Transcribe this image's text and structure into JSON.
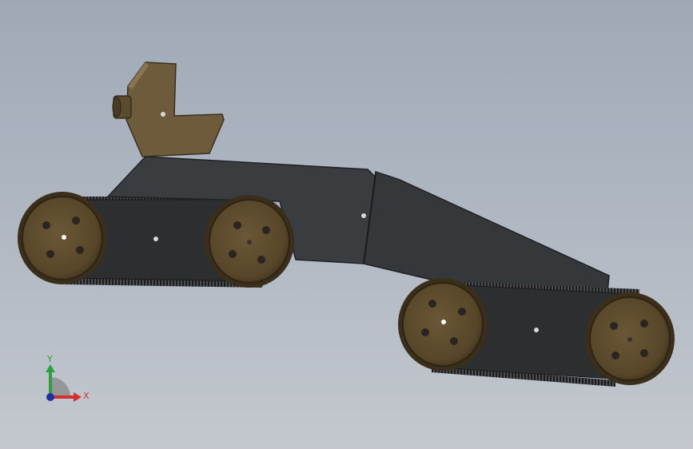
{
  "triad": {
    "x_label": "X",
    "y_label": "Y",
    "colors": {
      "x": "#d32f2f",
      "y": "#2e9e3e",
      "z": "#2030a0"
    }
  },
  "colors": {
    "background_top": "#9fa9b6",
    "background_bottom": "#c4c8ce",
    "chassis": "#3a3d40",
    "chassis_edge": "#1f2123",
    "wheel": "#6f5a3a",
    "wheel_face": "#5c4a2e",
    "track": "#2b2d2f",
    "bracket": "#6e5b3c"
  },
  "icons": [
    "coordinate-triad-icon"
  ]
}
